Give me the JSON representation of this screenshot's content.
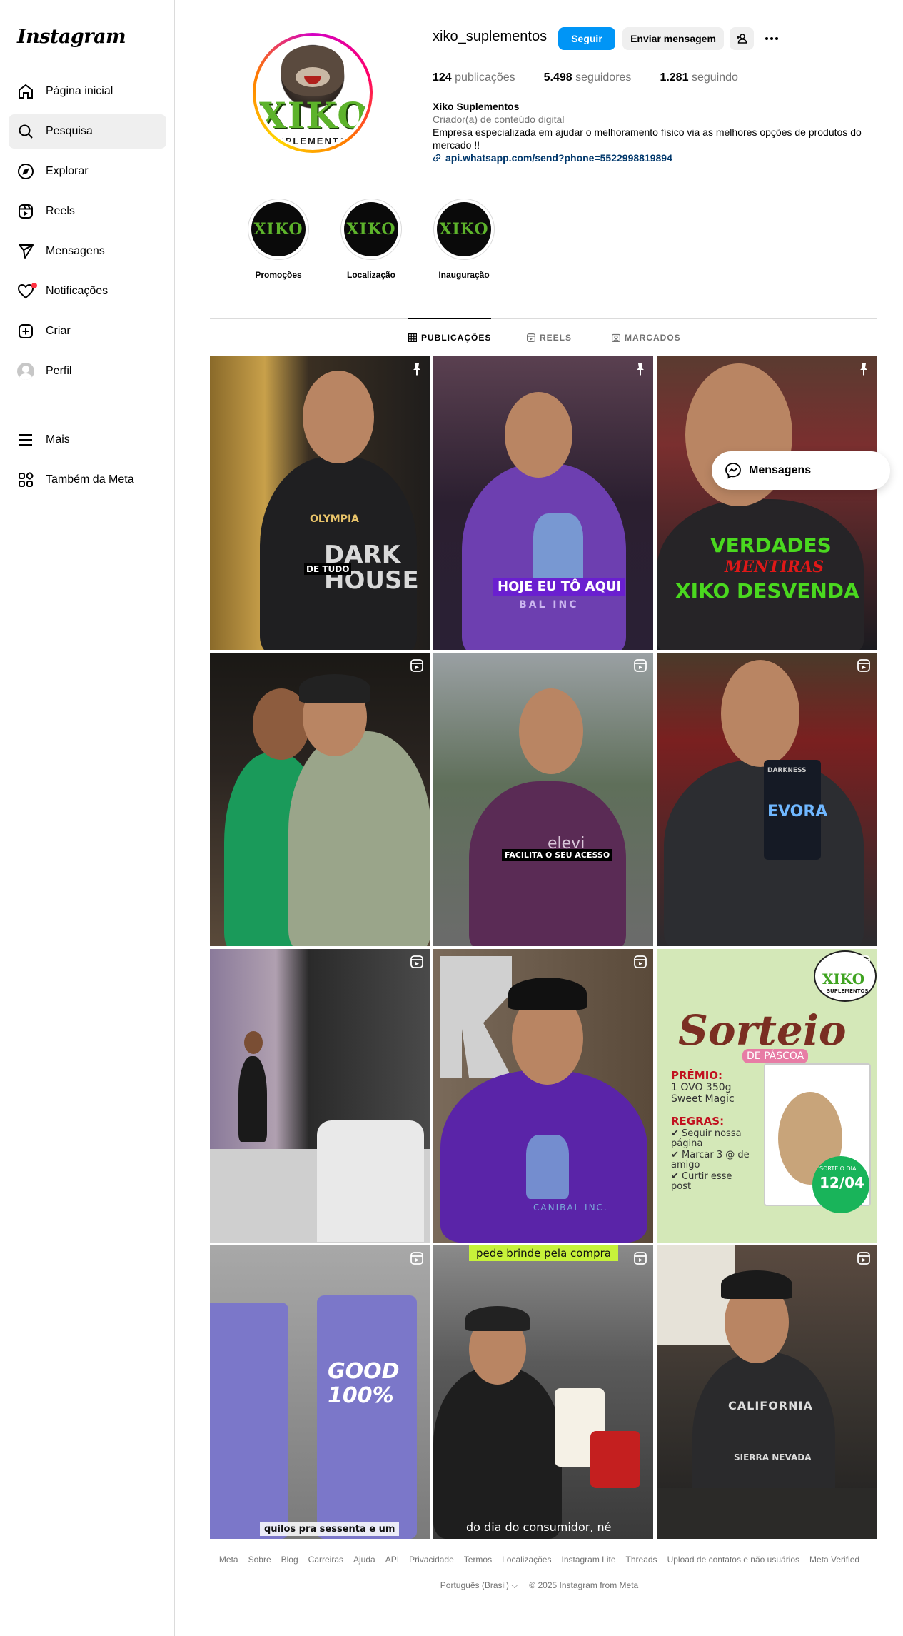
{
  "sidebar": {
    "logo": "Instagram",
    "items": [
      {
        "label": "Página inicial",
        "icon": "home-icon"
      },
      {
        "label": "Pesquisa",
        "icon": "search-icon"
      },
      {
        "label": "Explorar",
        "icon": "compass-icon"
      },
      {
        "label": "Reels",
        "icon": "reels-icon"
      },
      {
        "label": "Mensagens",
        "icon": "send-icon"
      },
      {
        "label": "Notificações",
        "icon": "heart-icon"
      },
      {
        "label": "Criar",
        "icon": "plus-square-icon"
      },
      {
        "label": "Perfil",
        "icon": "avatar-icon"
      }
    ],
    "more": [
      {
        "label": "Mais",
        "icon": "menu-icon"
      },
      {
        "label": "Também da Meta",
        "icon": "meta-apps-icon"
      }
    ]
  },
  "profile": {
    "username": "xiko_suplementos",
    "follow_label": "Seguir",
    "message_label": "Enviar mensagem",
    "pic_text": "XIKO",
    "pic_sub": "SUPLEMENTOS",
    "stats": {
      "posts": "124",
      "posts_label": "publicações",
      "followers": "5.498",
      "followers_label": "seguidores",
      "following": "1.281",
      "following_label": "seguindo"
    },
    "bio": {
      "name": "Xiko Suplementos",
      "category": "Criador(a) de conteúdo digital",
      "text": "Empresa especializada em ajudar o melhoramento físico via as melhores opções de produtos do mercado !!",
      "link": "api.whatsapp.com/send?phone=5522998819894"
    }
  },
  "highlights": [
    {
      "label": "Promoções",
      "text": "XIKO"
    },
    {
      "label": "Localização",
      "text": "XIKO"
    },
    {
      "label": "Inauguração",
      "text": "XIKO"
    }
  ],
  "tabs": [
    {
      "label": "PUBLICAÇÕES"
    },
    {
      "label": "REELS"
    },
    {
      "label": "MARCADOS"
    }
  ],
  "posts": [
    {
      "caption": "DE TUDO",
      "shirt_text": "DARK HOUSE",
      "logo_text": "OLYMPIA",
      "badge": "pin-icon"
    },
    {
      "caption": "HOJE EU TÔ AQUI",
      "shirt_text": "BAL INC",
      "badge": "pin-icon"
    },
    {
      "caption1": "VERDADES",
      "caption2": "MENTIRAS",
      "caption3": "XIKO DESVENDA",
      "badge": "pin-icon"
    },
    {
      "badge": "reel-icon"
    },
    {
      "caption": "FACILITA O SEU ACESSO",
      "shirt_text": "elevi",
      "badge": "reel-icon"
    },
    {
      "product_text": "EVORA",
      "product_top": "DARKNESS",
      "badge": "reel-icon"
    },
    {
      "badge": "reel-icon"
    },
    {
      "shirt_text": "CANIBAL INC.",
      "badge": "reel-icon"
    },
    {
      "logo": "XIKO",
      "logo_sub": "SUPLEMENTOS",
      "title": "Sorteio",
      "subtitle": "DE PÁSCOA",
      "prize_label": "PRÊMIO:",
      "prize": "1 OVO 350g Sweet Magic",
      "rules_label": "REGRAS:",
      "rules": [
        "Seguir nossa página",
        "Marcar 3 @ de amigo",
        "Curtir esse post"
      ],
      "draw_label": "SORTEIO DIA",
      "draw_date": "12/04",
      "badge": "reel-icon"
    },
    {
      "caption": "quilos pra sessenta e um",
      "product_text": "GOOD 100%",
      "badge": "reel-icon"
    },
    {
      "caption_top": "pede brinde pela compra",
      "caption": "do dia do consumidor, né",
      "badge": "reel-icon"
    },
    {
      "shirt_text": "CALIFORNIA",
      "shirt_text2": "SIERRA NEVADA",
      "badge": "reel-icon"
    }
  ],
  "footer": {
    "links": [
      "Meta",
      "Sobre",
      "Blog",
      "Carreiras",
      "Ajuda",
      "API",
      "Privacidade",
      "Termos",
      "Localizações",
      "Instagram Lite",
      "Threads",
      "Upload de contatos e não usuários",
      "Meta Verified"
    ],
    "language": "Português (Brasil)",
    "copyright": "© 2025 Instagram from Meta"
  },
  "messages_float": {
    "label": "Mensagens"
  }
}
